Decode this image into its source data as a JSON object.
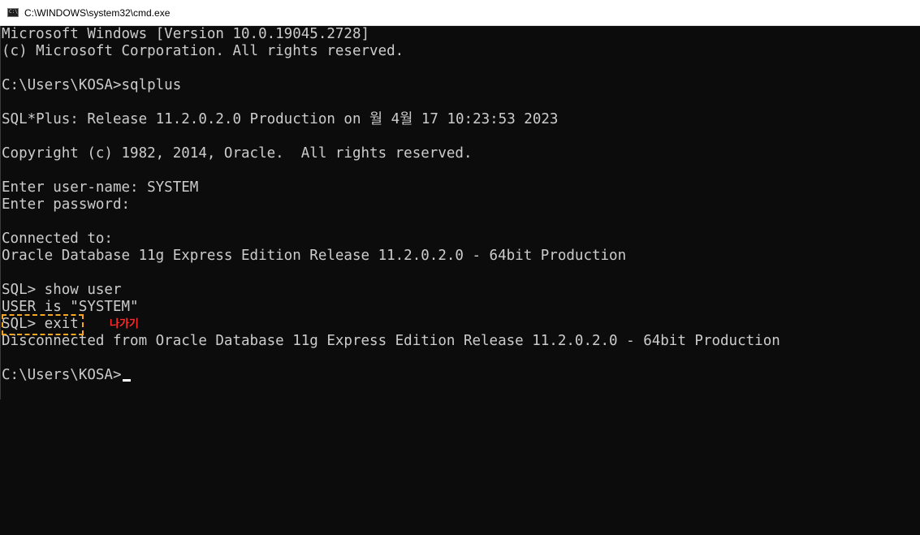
{
  "window": {
    "title": "C:\\WINDOWS\\system32\\cmd.exe",
    "icon": "cmd-icon",
    "icon_glyph": "C:\\"
  },
  "console": {
    "lines": [
      "Microsoft Windows [Version 10.0.19045.2728]",
      "(c) Microsoft Corporation. All rights reserved.",
      "",
      "C:\\Users\\KOSA>sqlplus",
      "",
      "SQL*Plus: Release 11.2.0.2.0 Production on 월 4월 17 10:23:53 2023",
      "",
      "Copyright (c) 1982, 2014, Oracle.  All rights reserved.",
      "",
      "Enter user-name: SYSTEM",
      "Enter password:",
      "",
      "Connected to:",
      "Oracle Database 11g Express Edition Release 11.2.0.2.0 - 64bit Production",
      "",
      "SQL> show user",
      "USER is \"SYSTEM\"",
      "SQL> exit",
      "Disconnected from Oracle Database 11g Express Edition Release 11.2.0.2.0 - 64bit Production",
      "",
      "C:\\Users\\KOSA>"
    ]
  },
  "annotation": {
    "text": "나가기",
    "color": "#ff2b2b",
    "box_color": "#f5a623"
  },
  "colors": {
    "background": "#0c0c0c",
    "text": "#cccccc",
    "titlebar": "#ffffff"
  }
}
